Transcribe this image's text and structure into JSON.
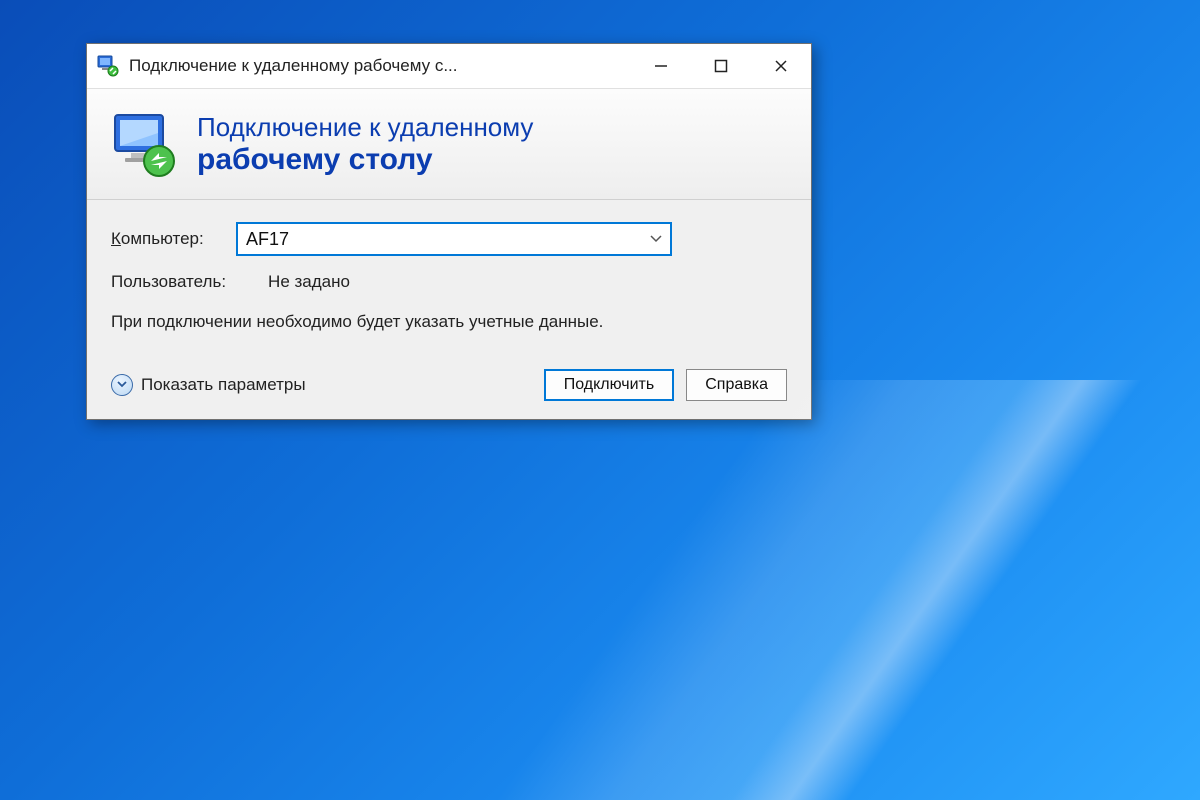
{
  "titlebar": {
    "title": "Подключение к удаленному рабочему с..."
  },
  "banner": {
    "line1": "Подключение к удаленному",
    "line2": "рабочему столу"
  },
  "form": {
    "computer_label": "омпьютер:",
    "computer_value": "AF17",
    "user_label": "Пользователь:",
    "user_value": "Не задано",
    "note": "При подключении необходимо будет указать учетные данные."
  },
  "footer": {
    "show_options": "оказать параметры",
    "connect": "Подключить",
    "help": "правка"
  }
}
